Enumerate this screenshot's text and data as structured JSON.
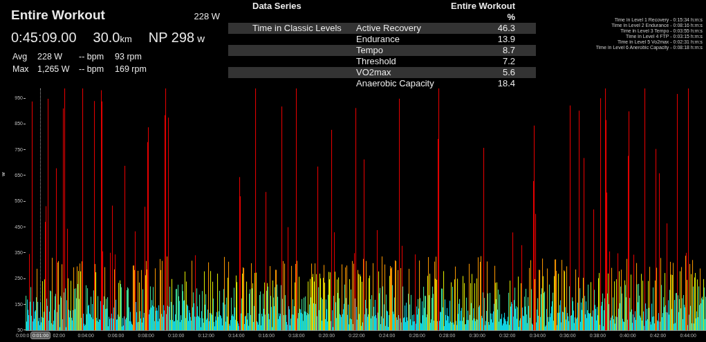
{
  "summary": {
    "title": "Entire Workout",
    "header_power": "228 W",
    "duration": "0:45:09.00",
    "distance": "30.0",
    "distance_unit": "km",
    "np": "NP 298",
    "np_unit": "w",
    "rows": [
      {
        "label": "Avg",
        "power": "228 W",
        "hr": "-- bpm",
        "cadence": "93 rpm"
      },
      {
        "label": "Max",
        "power": "1,265 W",
        "hr": "-- bpm",
        "cadence": "169 rpm"
      }
    ]
  },
  "table": {
    "columns": [
      "Data Series",
      "Entire Workout"
    ],
    "unit": "%",
    "series": "Time in Classic Levels",
    "rows": [
      {
        "level": "Active Recovery",
        "value": "46.3"
      },
      {
        "level": "Endurance",
        "value": "13.9"
      },
      {
        "level": "Tempo",
        "value": "8.7"
      },
      {
        "level": "Threshold",
        "value": "7.2"
      },
      {
        "level": "VO2max",
        "value": "5.6"
      },
      {
        "level": "Anaerobic Capacity",
        "value": "18.4"
      }
    ]
  },
  "legend": [
    "Time in Level 1 Recovery - 0:15:34 h:m:s",
    "Time in Level 2 Endurance - 0:08:16 h:m:s",
    "Time in Level 3 Tempo - 0:03:55 h:m:s",
    "Time in Level 4 FTP - 0:03:15 h:m:s",
    "Time in Level 5 Vo2max - 0:02:31 h:m:s",
    "Time in Level 6 Anerobic Capacity - 0:08:18 h:m:s"
  ],
  "chart": {
    "y_label": "w",
    "y_ticks": [
      "950",
      "850",
      "750",
      "650",
      "550",
      "450",
      "350",
      "250",
      "150",
      "50"
    ],
    "x_ticks": [
      "0:00:0",
      "02:00",
      "0:04:00",
      "0:06:00",
      "0:08:00",
      "0:10:00",
      "0:12:00",
      "0:14:00",
      "0:16:00",
      "0:18:00",
      "0:20:00",
      "0:22:00",
      "0:24:00",
      "0:26:00",
      "0:28:00",
      "0:30:00",
      "0:32:00",
      "0:34:00",
      "0:36:00",
      "0:38:00",
      "0:40:00",
      "0:42:00",
      "0:44:00"
    ],
    "cursor": "0:01:00"
  }
}
